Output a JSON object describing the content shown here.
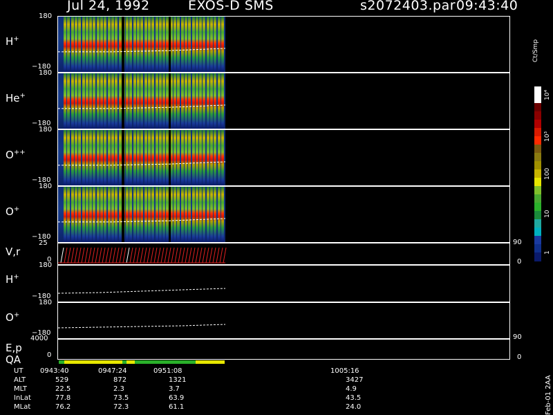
{
  "header": {
    "date": "Jul 24, 1992",
    "instrument": "EXOS-D SMS",
    "file": "s2072403.par",
    "time": "09:43:40"
  },
  "panels": [
    {
      "label": "H",
      "sup": "+",
      "ymax": "180",
      "ymin": "−180"
    },
    {
      "label": "He",
      "sup": "+",
      "ymax": "180",
      "ymin": "−180"
    },
    {
      "label": "O",
      "sup": "++",
      "ymax": "180",
      "ymin": "−180"
    },
    {
      "label": "O",
      "sup": "+",
      "ymax": "180",
      "ymin": "−180"
    }
  ],
  "vr": {
    "label": "V,r",
    "ytop": "25",
    "ybot": "0",
    "rtop": "90",
    "rbot": "0"
  },
  "hplus2": {
    "label": "H",
    "sup": "+",
    "ymax": "180",
    "ymin": "−180"
  },
  "oplus2": {
    "label": "O",
    "sup": "+",
    "ymax": "180",
    "ymin": "−180"
  },
  "ep": {
    "label": "E,p",
    "ytop": "4000",
    "ybot": "0",
    "rtop": "90",
    "rbot": "0"
  },
  "qa": {
    "label": "QA"
  },
  "colorbar": {
    "units": "Ct/Smp",
    "ticks": [
      "10⁴",
      "10³",
      "100",
      "10",
      "1"
    ]
  },
  "footer": {
    "rows": [
      {
        "name": "UT",
        "values": [
          "0943:40",
          "0947:24",
          "0951:08",
          "1005:16"
        ]
      },
      {
        "name": "ALT",
        "values": [
          "529",
          "872",
          "1321",
          "3427"
        ]
      },
      {
        "name": "MLT",
        "values": [
          "22.5",
          "2.3",
          "3.7",
          "4.9"
        ]
      },
      {
        "name": "InLat",
        "values": [
          "77.8",
          "73.5",
          "63.9",
          "43.5"
        ]
      },
      {
        "name": "MLat",
        "values": [
          "76.2",
          "72.3",
          "61.1",
          "24.0"
        ]
      }
    ],
    "stamp": "Feb-01 2AA"
  },
  "chart_data": {
    "type": "heatmap",
    "title": "Jul 24, 1992   EXOS-D SMS",
    "x_ticks_ut": [
      "0943:40",
      "0947:24",
      "0951:08",
      "1005:16"
    ],
    "panels": [
      "H+",
      "He+",
      "O++",
      "O+"
    ],
    "y_range": [
      -180,
      180
    ],
    "colorbar": {
      "units": "Ct/Smp",
      "scale": "log",
      "range": [
        1,
        10000
      ]
    }
  }
}
